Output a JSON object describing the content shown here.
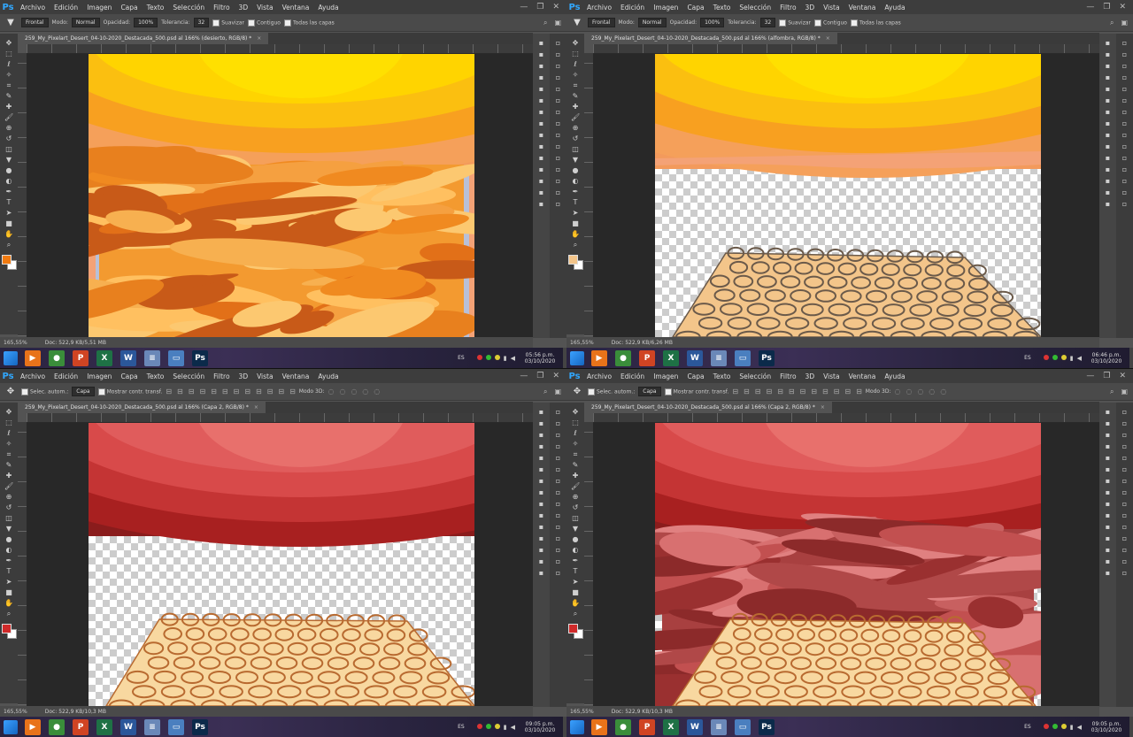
{
  "menu": [
    "Archivo",
    "Edición",
    "Imagen",
    "Capa",
    "Texto",
    "Selección",
    "Filtro",
    "3D",
    "Vista",
    "Ventana",
    "Ayuda"
  ],
  "app_logo": "Ps",
  "options_fill": {
    "source": "Frontal",
    "mode_label": "Modo:",
    "mode": "Normal",
    "opacity_label": "Opacidad:",
    "opacity": "100%",
    "tolerance_label": "Tolerancia:",
    "tolerance": "32",
    "smooth": "Suavizar",
    "contiguous": "Contiguo",
    "all_layers": "Todas las capas"
  },
  "options_move": {
    "auto_select": "Selec. autom.:",
    "layer": "Capa",
    "show_transform": "Mostrar contr. transf.",
    "mode3d": "Modo 3D:"
  },
  "panes": [
    {
      "tab": "259_My_Pixelart_Desert_04-10-2020_Destacada_500.psd al 166% (desierto, RGB/8) *",
      "zoom": "165,55%",
      "doc": "Doc: 522,9 KB/5,51 MB",
      "time": "05:56 p.m.",
      "date": "03/10/2020",
      "fg": "#f07a10",
      "bg": "#ffffff"
    },
    {
      "tab": "259_My_Pixelart_Desert_04-10-2020_Destacada_500.psd al 166% (alfombra, RGB/8) *",
      "zoom": "165,55%",
      "doc": "Doc: 522,9 KB/6,26 MB",
      "time": "06:46 p.m.",
      "date": "03/10/2020",
      "fg": "#f3c58a",
      "bg": "#ffffff"
    },
    {
      "tab": "259_My_Pixelart_Desert_04-10-2020_Destacada_500.psd al 166% (Capa 2, RGB/8) *",
      "zoom": "165,55%",
      "doc": "Doc: 522,9 KB/10,3 MB",
      "time": "09:05 p.m.",
      "date": "03/10/2020",
      "fg": "#d02a2a",
      "bg": "#ffffff"
    },
    {
      "tab": "259_My_Pixelart_Desert_04-10-2020_Destacada_500.psd al 166% (Capa 2, RGB/8) *",
      "zoom": "165,55%",
      "doc": "Doc: 522,9 KB/10,3 MB",
      "time": "09:05 p.m.",
      "date": "03/10/2020",
      "fg": "#d02a2a",
      "bg": "#ffffff"
    }
  ],
  "taskbar": {
    "lang": "ES",
    "apps": [
      {
        "name": "media-player-icon",
        "glyph": "▶",
        "color": "#e8731a"
      },
      {
        "name": "chrome-icon",
        "glyph": "●",
        "color": "#3a8d3a"
      },
      {
        "name": "powerpoint-icon",
        "glyph": "P",
        "color": "#d04423"
      },
      {
        "name": "excel-icon",
        "glyph": "X",
        "color": "#1e7145"
      },
      {
        "name": "word-icon",
        "glyph": "W",
        "color": "#2b579a"
      },
      {
        "name": "notepad-icon",
        "glyph": "≡",
        "color": "#6a88b8"
      },
      {
        "name": "explorer-icon",
        "glyph": "▭",
        "color": "#4a7fbf"
      },
      {
        "name": "photoshop-icon",
        "glyph": "Ps",
        "color": "#0b2a4a"
      }
    ]
  },
  "colors": {
    "ps_blue": "#31a8ff",
    "desert_sky": "#f39a5c",
    "desert_sun": "#ffe000",
    "red_sky": "#8a1c1c",
    "red_sun": "#e8706c",
    "carpet": "#f3c58a"
  }
}
